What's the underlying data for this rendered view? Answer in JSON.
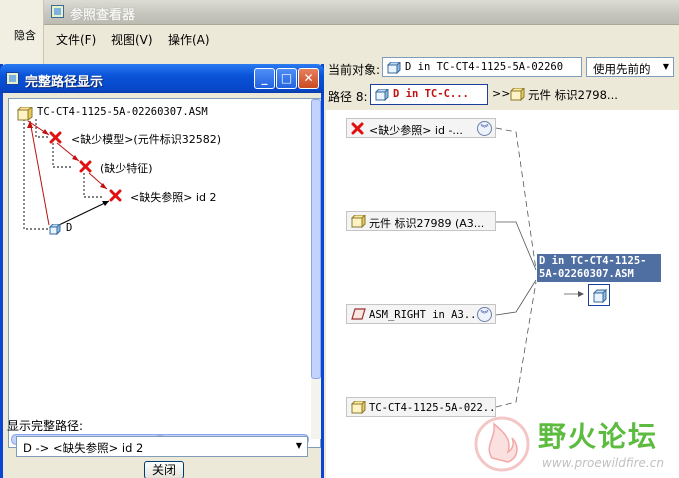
{
  "background": {
    "side_label": "隐含"
  },
  "main_window": {
    "title": "参照查看器",
    "menu": [
      {
        "label": "文件(F)"
      },
      {
        "label": "视图(V)"
      },
      {
        "label": "操作(A)"
      }
    ],
    "current_object_label": "当前对象:",
    "current_object_value": "D in TC-CT4-1125-5A-02260",
    "use_previous": "使用先前的",
    "path_label": "路径 8:",
    "path_segment_1": "D in TC-C...",
    "path_arrow": ">>",
    "path_segment_2": "元件 标识2798...",
    "graph": {
      "nodes": [
        {
          "label": "<缺少参照> id -..."
        },
        {
          "label": "元件 标识27989 (A3..."
        },
        {
          "label": "ASM_RIGHT in A3..."
        },
        {
          "label": "TC-CT4-1125-5A-022..."
        }
      ],
      "target_label": "D in TC-CT4-1125-5A-02260307.ASM"
    },
    "watermark": {
      "title": "野火论坛",
      "url": "www.proewildfire.cn"
    }
  },
  "dialog": {
    "title": "完整路径显示",
    "tree": {
      "root": "TC-CT4-1125-5A-02260307.ASM",
      "missing_model": "<缺少模型>(元件标识32582)",
      "missing_feature": "(缺少特征)",
      "missing_ref": "<缺失参照> id 2",
      "leaf": "D"
    },
    "show_full_path_label": "显示完整路径:",
    "full_path_value": "D -> <缺失参照> id 2",
    "close_label": "关闭"
  },
  "colors": {
    "xp_blue": "#0a53d8",
    "error_red": "#e01010",
    "link_red": "#c01010",
    "watermark_green": "#5dbb3f"
  }
}
